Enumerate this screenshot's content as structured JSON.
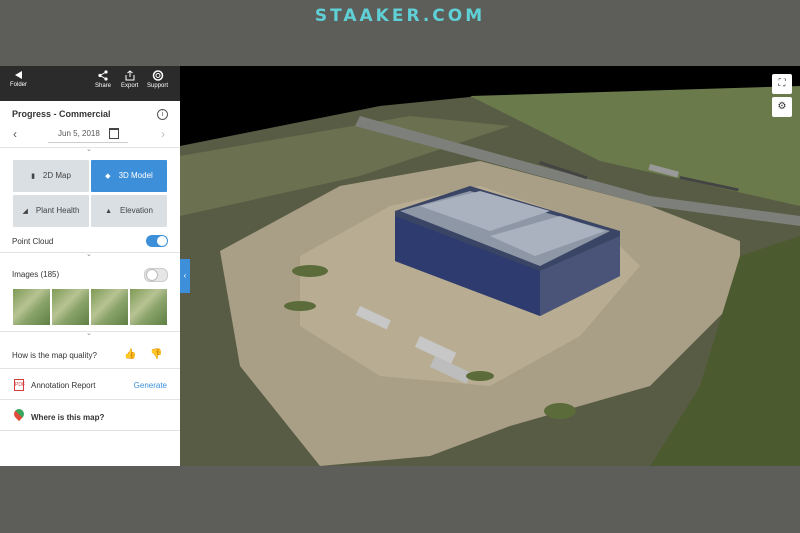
{
  "watermark": "STAAKER.COM",
  "topbar": {
    "folder_label": "Folder",
    "share_label": "Share",
    "export_label": "Export",
    "support_label": "Support"
  },
  "project": {
    "title": "Progress - Commercial",
    "date": "Jun 5, 2018"
  },
  "views": {
    "map2d": "2D Map",
    "model3d": "3D Model",
    "plant_health": "Plant Health",
    "elevation": "Elevation",
    "active": "3D Model"
  },
  "point_cloud": {
    "label": "Point Cloud",
    "enabled": true
  },
  "images": {
    "label": "Images (185)",
    "enabled": false,
    "thumbnail_count": 4
  },
  "quality": {
    "question": "How is the map quality?"
  },
  "annotation_report": {
    "label": "Annotation Report",
    "action": "Generate"
  },
  "location": {
    "label": "Where is this map?"
  },
  "colors": {
    "accent": "#3d8fd9",
    "topbar": "#2b2b2b",
    "watermark": "#5fd0d6",
    "background": "#5d5e59"
  },
  "icons": [
    "back-arrow-icon",
    "share-icon",
    "export-icon",
    "support-icon",
    "info-icon",
    "calendar-icon",
    "map-icon",
    "cube-icon",
    "leaf-icon",
    "mountain-icon",
    "thumbs-up-icon",
    "thumbs-down-icon",
    "pdf-icon",
    "map-pin-icon",
    "fit-screen-icon",
    "settings-icon"
  ]
}
